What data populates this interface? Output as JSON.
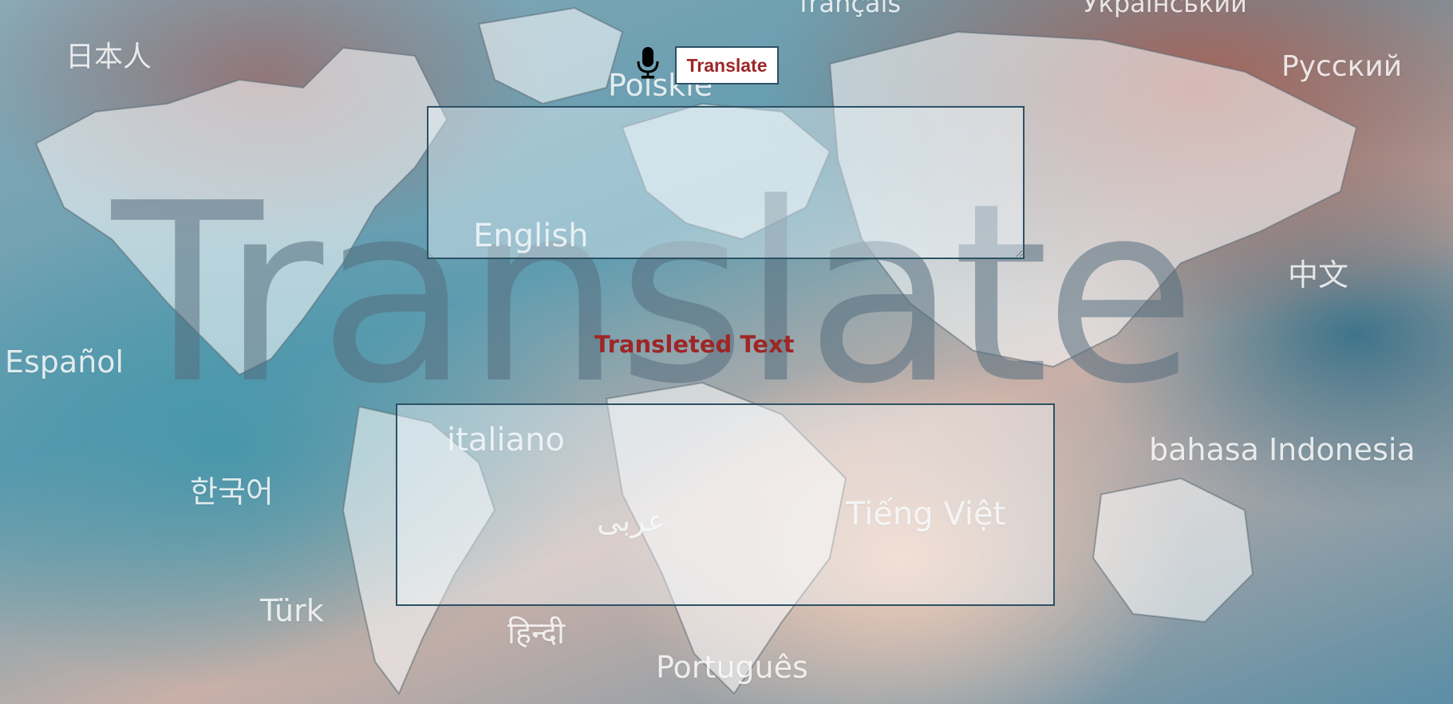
{
  "background": {
    "big_word": "Translate",
    "languages": {
      "japanese": "日本人",
      "polish": "Polskie",
      "french": "français",
      "ukrainian": "Український",
      "russian": "Русский",
      "english": "English",
      "chinese": "中文",
      "spanish": "Español",
      "italian": "italiano",
      "indonesian": "bahasa Indonesia",
      "korean": "한국어",
      "arabic": "عربى",
      "vietnamese": "Tiếng Việt",
      "turkish": "Türk",
      "hindi": "हिन्दी",
      "portuguese": "Português"
    }
  },
  "toolbar": {
    "mic_icon": "microphone-icon",
    "translate_label": "Translate"
  },
  "source": {
    "value": "",
    "placeholder": ""
  },
  "result": {
    "heading": "Transleted Text",
    "text": ""
  },
  "colors": {
    "accent": "#9e2626",
    "border": "#2d5164"
  }
}
